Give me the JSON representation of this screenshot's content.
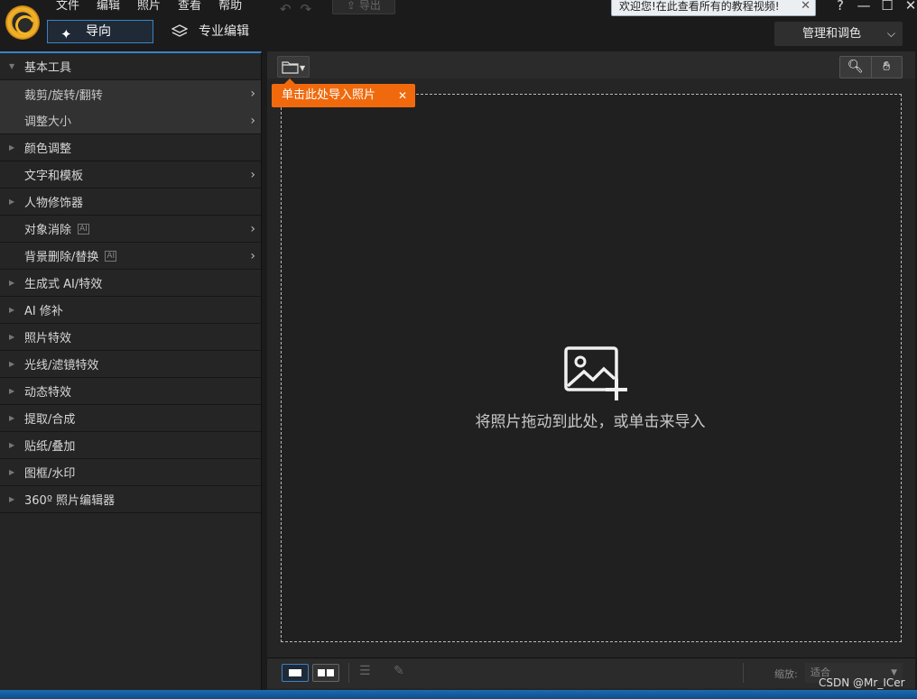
{
  "menu": [
    "文件",
    "编辑",
    "照片",
    "查看",
    "帮助"
  ],
  "toolbar_top": {
    "export_label": "导出"
  },
  "welcome_tip": {
    "text": "欢迎您!在此查看所有的教程视频!",
    "close": "✕"
  },
  "window_controls": [
    "?",
    "—",
    "☐",
    "✕"
  ],
  "modes": {
    "guide": "导向",
    "pro": "专业编辑",
    "manage": "管理和调色"
  },
  "sidebar": {
    "header": "基本工具",
    "subitems": [
      "裁剪/旋转/翻转",
      "调整大小"
    ],
    "items": [
      {
        "label": "颜色调整",
        "tri": true,
        "arrow": false,
        "ai": false
      },
      {
        "label": "文字和模板",
        "tri": false,
        "arrow": true,
        "ai": false
      },
      {
        "label": "人物修饰器",
        "tri": true,
        "arrow": false,
        "ai": false
      },
      {
        "label": "对象消除",
        "tri": false,
        "arrow": true,
        "ai": true
      },
      {
        "label": "背景删除/替换",
        "tri": false,
        "arrow": true,
        "ai": true
      },
      {
        "label": "生成式 AI/特效",
        "tri": true,
        "arrow": false,
        "ai": false
      },
      {
        "label": "AI 修补",
        "tri": true,
        "arrow": false,
        "ai": false
      },
      {
        "label": "照片特效",
        "tri": true,
        "arrow": false,
        "ai": false
      },
      {
        "label": "光线/滤镜特效",
        "tri": true,
        "arrow": false,
        "ai": false
      },
      {
        "label": "动态特效",
        "tri": true,
        "arrow": false,
        "ai": false
      },
      {
        "label": "提取/合成",
        "tri": true,
        "arrow": false,
        "ai": false
      },
      {
        "label": "贴纸/叠加",
        "tri": true,
        "arrow": false,
        "ai": false
      },
      {
        "label": "图框/水印",
        "tri": true,
        "arrow": false,
        "ai": false
      },
      {
        "label": "360º 照片编辑器",
        "tri": true,
        "arrow": false,
        "ai": false
      }
    ],
    "ai_badge": "AI"
  },
  "callout": {
    "text": "单击此处导入照片",
    "close": "✕"
  },
  "dropzone": {
    "text": "将照片拖动到此处，或单击来导入"
  },
  "bottom": {
    "zoom_label": "缩放:",
    "zoom_value": "适合"
  },
  "watermark": "CSDN @Mr_ICer",
  "colors": {
    "accent": "#3b82c4",
    "callout": "#f06a0d",
    "bg": "#252526"
  }
}
